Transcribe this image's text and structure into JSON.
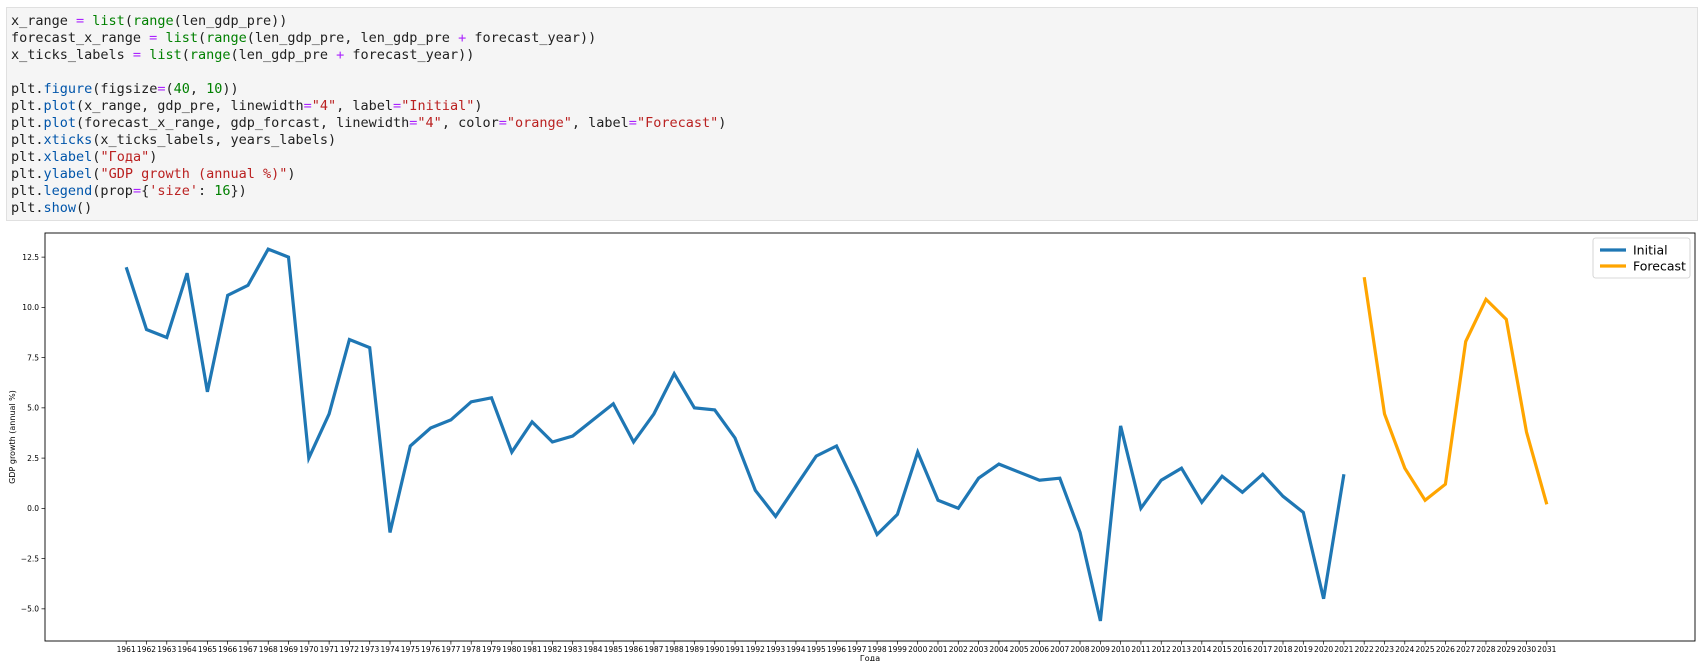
{
  "code_cell": {
    "lines": [
      [
        [
          "x_range",
          "p"
        ],
        [
          " = ",
          "op"
        ],
        [
          "list",
          "b"
        ],
        [
          "(",
          "p"
        ],
        [
          "range",
          "b"
        ],
        [
          "(len_gdp_pre))",
          "p"
        ]
      ],
      [
        [
          "forecast_x_range",
          "p"
        ],
        [
          " = ",
          "op"
        ],
        [
          "list",
          "b"
        ],
        [
          "(",
          "p"
        ],
        [
          "range",
          "b"
        ],
        [
          "(len_gdp_pre, len_gdp_pre ",
          "p"
        ],
        [
          "+",
          "op"
        ],
        [
          " forecast_year))",
          "p"
        ]
      ],
      [
        [
          "x_ticks_labels",
          "p"
        ],
        [
          " = ",
          "op"
        ],
        [
          "list",
          "b"
        ],
        [
          "(",
          "p"
        ],
        [
          "range",
          "b"
        ],
        [
          "(len_gdp_pre ",
          "p"
        ],
        [
          "+",
          "op"
        ],
        [
          " forecast_year))",
          "p"
        ]
      ],
      [],
      [
        [
          "plt.",
          "p"
        ],
        [
          "figure",
          "f"
        ],
        [
          "(figsize",
          "p"
        ],
        [
          "=",
          "op"
        ],
        [
          "(",
          "p"
        ],
        [
          "40",
          "n"
        ],
        [
          ", ",
          "p"
        ],
        [
          "10",
          "n"
        ],
        [
          "))",
          "p"
        ]
      ],
      [
        [
          "plt.",
          "p"
        ],
        [
          "plot",
          "f"
        ],
        [
          "(x_range, gdp_pre, linewidth",
          "p"
        ],
        [
          "=",
          "op"
        ],
        [
          "\"4\"",
          "s"
        ],
        [
          ", label",
          "p"
        ],
        [
          "=",
          "op"
        ],
        [
          "\"Initial\"",
          "s"
        ],
        [
          ")",
          "p"
        ]
      ],
      [
        [
          "plt.",
          "p"
        ],
        [
          "plot",
          "f"
        ],
        [
          "(forecast_x_range, gdp_forcast, linewidth",
          "p"
        ],
        [
          "=",
          "op"
        ],
        [
          "\"4\"",
          "s"
        ],
        [
          ", color",
          "p"
        ],
        [
          "=",
          "op"
        ],
        [
          "\"orange\"",
          "s"
        ],
        [
          ", label",
          "p"
        ],
        [
          "=",
          "op"
        ],
        [
          "\"Forecast\"",
          "s"
        ],
        [
          ")",
          "p"
        ]
      ],
      [
        [
          "plt.",
          "p"
        ],
        [
          "xticks",
          "f"
        ],
        [
          "(x_ticks_labels, years_labels)",
          "p"
        ]
      ],
      [
        [
          "plt.",
          "p"
        ],
        [
          "xlabel",
          "f"
        ],
        [
          "(",
          "p"
        ],
        [
          "\"Года\"",
          "s"
        ],
        [
          ")",
          "p"
        ]
      ],
      [
        [
          "plt.",
          "p"
        ],
        [
          "ylabel",
          "f"
        ],
        [
          "(",
          "p"
        ],
        [
          "\"GDP growth (annual %)\"",
          "s"
        ],
        [
          ")",
          "p"
        ]
      ],
      [
        [
          "plt.",
          "p"
        ],
        [
          "legend",
          "f"
        ],
        [
          "(prop",
          "p"
        ],
        [
          "=",
          "op"
        ],
        [
          "{",
          "p"
        ],
        [
          "'size'",
          "s"
        ],
        [
          ": ",
          "p"
        ],
        [
          "16",
          "n"
        ],
        [
          "})",
          "p"
        ]
      ],
      [
        [
          "plt.",
          "p"
        ],
        [
          "show",
          "f"
        ],
        [
          "()",
          "p"
        ]
      ]
    ]
  },
  "chart_data": {
    "type": "line",
    "title": "",
    "xlabel": "Года",
    "ylabel": "GDP growth (annual %)",
    "x": [
      "1961",
      "1962",
      "1963",
      "1964",
      "1965",
      "1966",
      "1967",
      "1968",
      "1969",
      "1970",
      "1971",
      "1972",
      "1973",
      "1974",
      "1975",
      "1976",
      "1977",
      "1978",
      "1979",
      "1980",
      "1981",
      "1982",
      "1983",
      "1984",
      "1985",
      "1986",
      "1987",
      "1988",
      "1989",
      "1990",
      "1991",
      "1992",
      "1993",
      "1994",
      "1995",
      "1996",
      "1997",
      "1998",
      "1999",
      "2000",
      "2001",
      "2002",
      "2003",
      "2004",
      "2005",
      "2006",
      "2007",
      "2008",
      "2009",
      "2010",
      "2011",
      "2012",
      "2013",
      "2014",
      "2015",
      "2016",
      "2017",
      "2018",
      "2019",
      "2020",
      "2021",
      "2022",
      "2023",
      "2024",
      "2025",
      "2026",
      "2027",
      "2028",
      "2029",
      "2030",
      "2031"
    ],
    "yticks": [
      -5.0,
      -2.5,
      0.0,
      2.5,
      5.0,
      7.5,
      10.0,
      12.5
    ],
    "ytick_labels": [
      "−5.0",
      "−2.5",
      "0.0",
      "2.5",
      "5.0",
      "7.5",
      "10.0",
      "12.5"
    ],
    "ylim": [
      -6.6,
      13.7
    ],
    "grid": false,
    "legend_position": "top-right",
    "series": [
      {
        "name": "Initial",
        "color": "#1f77b4",
        "start_index": 0,
        "values": [
          12.0,
          8.9,
          8.5,
          11.7,
          5.8,
          10.6,
          11.1,
          12.9,
          12.5,
          2.5,
          4.7,
          8.4,
          8.0,
          -1.2,
          3.1,
          4.0,
          4.4,
          5.3,
          5.5,
          2.8,
          4.3,
          3.3,
          3.6,
          4.4,
          5.2,
          3.3,
          4.7,
          6.7,
          5.0,
          4.9,
          3.5,
          0.9,
          -0.4,
          1.1,
          2.6,
          3.1,
          1.0,
          -1.3,
          -0.3,
          2.8,
          0.4,
          0.0,
          1.5,
          2.2,
          1.8,
          1.4,
          1.5,
          -1.2,
          -5.6,
          4.1,
          0.0,
          1.4,
          2.0,
          0.3,
          1.6,
          0.8,
          1.7,
          0.6,
          -0.2,
          -4.5,
          1.7
        ]
      },
      {
        "name": "Forecast",
        "color": "#ffa500",
        "start_index": 61,
        "values": [
          11.5,
          4.7,
          2.0,
          0.4,
          1.2,
          8.3,
          10.4,
          9.4,
          3.8,
          0.2
        ]
      }
    ]
  }
}
